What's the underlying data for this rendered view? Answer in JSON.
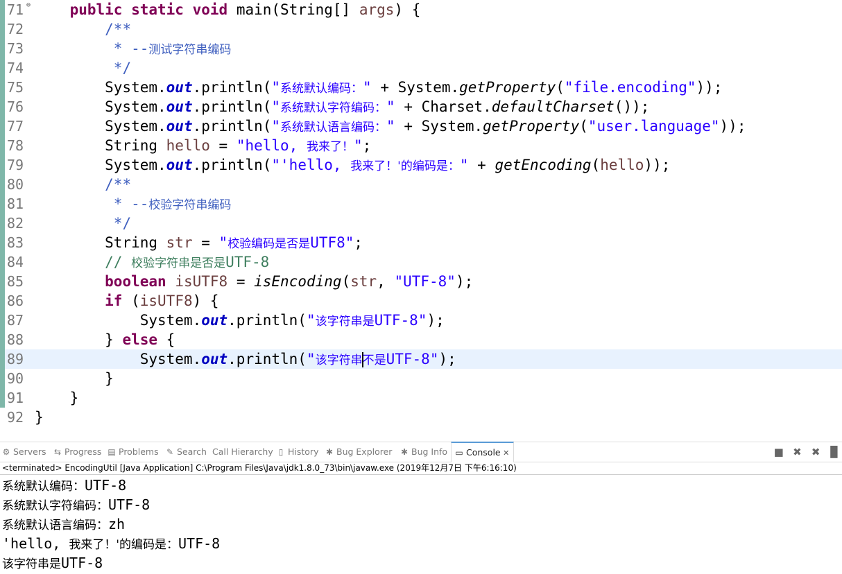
{
  "editor": {
    "lines": [
      {
        "num": "71",
        "fold": "⊖",
        "segs": [
          {
            "t": "    "
          },
          {
            "t": "public",
            "c": "kw"
          },
          {
            "t": " "
          },
          {
            "t": "static",
            "c": "kw"
          },
          {
            "t": " "
          },
          {
            "t": "void",
            "c": "kw"
          },
          {
            "t": " main(String[] "
          },
          {
            "t": "args",
            "c": "var"
          },
          {
            "t": ") {"
          }
        ]
      },
      {
        "num": "72",
        "segs": [
          {
            "t": "        "
          },
          {
            "t": "/**",
            "c": "jd"
          }
        ]
      },
      {
        "num": "73",
        "segs": [
          {
            "t": "         "
          },
          {
            "t": "* --",
            "c": "jd"
          },
          {
            "t": "测试字符串编码",
            "c": "jd zh"
          }
        ]
      },
      {
        "num": "74",
        "segs": [
          {
            "t": "         "
          },
          {
            "t": "*/",
            "c": "jd"
          }
        ]
      },
      {
        "num": "75",
        "segs": [
          {
            "t": "        System."
          },
          {
            "t": "out",
            "c": "fld"
          },
          {
            "t": ".println("
          },
          {
            "t": "\"",
            "c": "str"
          },
          {
            "t": "系统默认编码：",
            "c": "str zh"
          },
          {
            "t": "\"",
            "c": "str"
          },
          {
            "t": " + System."
          },
          {
            "t": "getProperty",
            "c": "sm"
          },
          {
            "t": "("
          },
          {
            "t": "\"file.encoding\"",
            "c": "str"
          },
          {
            "t": "));"
          }
        ]
      },
      {
        "num": "76",
        "segs": [
          {
            "t": "        System."
          },
          {
            "t": "out",
            "c": "fld"
          },
          {
            "t": ".println("
          },
          {
            "t": "\"",
            "c": "str"
          },
          {
            "t": "系统默认字符编码：",
            "c": "str zh"
          },
          {
            "t": "\"",
            "c": "str"
          },
          {
            "t": " + Charset."
          },
          {
            "t": "defaultCharset",
            "c": "sm"
          },
          {
            "t": "());"
          }
        ]
      },
      {
        "num": "77",
        "segs": [
          {
            "t": "        System."
          },
          {
            "t": "out",
            "c": "fld"
          },
          {
            "t": ".println("
          },
          {
            "t": "\"",
            "c": "str"
          },
          {
            "t": "系统默认语言编码：",
            "c": "str zh"
          },
          {
            "t": "\"",
            "c": "str"
          },
          {
            "t": " + System."
          },
          {
            "t": "getProperty",
            "c": "sm"
          },
          {
            "t": "("
          },
          {
            "t": "\"user.language\"",
            "c": "str"
          },
          {
            "t": "));"
          }
        ]
      },
      {
        "num": "78",
        "segs": [
          {
            "t": "        String "
          },
          {
            "t": "hello",
            "c": "var"
          },
          {
            "t": " = "
          },
          {
            "t": "\"hello, ",
            "c": "str"
          },
          {
            "t": "我来了！",
            "c": "str zh"
          },
          {
            "t": "\"",
            "c": "str"
          },
          {
            "t": ";"
          }
        ]
      },
      {
        "num": "79",
        "segs": [
          {
            "t": "        System."
          },
          {
            "t": "out",
            "c": "fld"
          },
          {
            "t": ".println("
          },
          {
            "t": "\"'hello, ",
            "c": "str"
          },
          {
            "t": "我来了！'的编码是：",
            "c": "str zh"
          },
          {
            "t": "\"",
            "c": "str"
          },
          {
            "t": " + "
          },
          {
            "t": "getEncoding",
            "c": "sm"
          },
          {
            "t": "("
          },
          {
            "t": "hello",
            "c": "var"
          },
          {
            "t": "));"
          }
        ]
      },
      {
        "num": "80",
        "segs": [
          {
            "t": "        "
          },
          {
            "t": "/**",
            "c": "jd"
          }
        ]
      },
      {
        "num": "81",
        "segs": [
          {
            "t": "         "
          },
          {
            "t": "* --",
            "c": "jd"
          },
          {
            "t": "校验字符串编码",
            "c": "jd zh"
          }
        ]
      },
      {
        "num": "82",
        "segs": [
          {
            "t": "         "
          },
          {
            "t": "*/",
            "c": "jd"
          }
        ]
      },
      {
        "num": "83",
        "segs": [
          {
            "t": "        String "
          },
          {
            "t": "str",
            "c": "var"
          },
          {
            "t": " = "
          },
          {
            "t": "\"",
            "c": "str"
          },
          {
            "t": "校验编码是否是",
            "c": "str zh"
          },
          {
            "t": "UTF8\"",
            "c": "str"
          },
          {
            "t": ";"
          }
        ]
      },
      {
        "num": "84",
        "segs": [
          {
            "t": "        "
          },
          {
            "t": "// ",
            "c": "cm"
          },
          {
            "t": "校验字符串是否是",
            "c": "cm zh"
          },
          {
            "t": "UTF-8",
            "c": "cm"
          }
        ]
      },
      {
        "num": "85",
        "segs": [
          {
            "t": "        "
          },
          {
            "t": "boolean",
            "c": "kw"
          },
          {
            "t": " "
          },
          {
            "t": "isUTF8",
            "c": "var"
          },
          {
            "t": " = "
          },
          {
            "t": "isEncoding",
            "c": "sm"
          },
          {
            "t": "("
          },
          {
            "t": "str",
            "c": "var"
          },
          {
            "t": ", "
          },
          {
            "t": "\"UTF-8\"",
            "c": "str"
          },
          {
            "t": ");"
          }
        ]
      },
      {
        "num": "86",
        "segs": [
          {
            "t": "        "
          },
          {
            "t": "if",
            "c": "kw"
          },
          {
            "t": " ("
          },
          {
            "t": "isUTF8",
            "c": "var"
          },
          {
            "t": ") {"
          }
        ]
      },
      {
        "num": "87",
        "segs": [
          {
            "t": "            System."
          },
          {
            "t": "out",
            "c": "fld"
          },
          {
            "t": ".println("
          },
          {
            "t": "\"",
            "c": "str"
          },
          {
            "t": "该字符串是",
            "c": "str zh"
          },
          {
            "t": "UTF-8\"",
            "c": "str"
          },
          {
            "t": ");"
          }
        ]
      },
      {
        "num": "88",
        "segs": [
          {
            "t": "        } "
          },
          {
            "t": "else",
            "c": "kw"
          },
          {
            "t": " {"
          }
        ]
      },
      {
        "num": "89",
        "current": true,
        "segs": [
          {
            "t": "            System."
          },
          {
            "t": "out",
            "c": "fld"
          },
          {
            "t": ".println("
          },
          {
            "t": "\"",
            "c": "str"
          },
          {
            "t": "该字符串",
            "c": "str zh"
          },
          {
            "cursor": true
          },
          {
            "t": "不是",
            "c": "str zh"
          },
          {
            "t": "UTF-8\"",
            "c": "str"
          },
          {
            "t": ");"
          }
        ]
      },
      {
        "num": "90",
        "segs": [
          {
            "t": "        }"
          }
        ]
      },
      {
        "num": "91",
        "segs": [
          {
            "t": "    }"
          }
        ]
      },
      {
        "num": "92",
        "nobar": true,
        "segs": [
          {
            "t": "}"
          }
        ]
      }
    ]
  },
  "views": {
    "tabs": [
      {
        "name": "tab-servers",
        "icon": "servers-icon",
        "glyph": "⚙",
        "label": "Servers",
        "active": false
      },
      {
        "name": "tab-progress",
        "icon": "progress-icon",
        "glyph": "⇆",
        "label": "Progress",
        "active": false
      },
      {
        "name": "tab-problems",
        "icon": "problems-icon",
        "glyph": "▤",
        "label": "Problems",
        "active": false
      },
      {
        "name": "tab-search",
        "icon": "search-icon",
        "glyph": "✎",
        "label": "Search",
        "active": false
      },
      {
        "name": "tab-call-hierarchy",
        "icon": "call-hierarchy-icon",
        "glyph": "",
        "label": "Call Hierarchy",
        "active": false
      },
      {
        "name": "tab-history",
        "icon": "history-icon",
        "glyph": "▯",
        "label": "History",
        "active": false
      },
      {
        "name": "tab-bug-explorer",
        "icon": "bug-explorer-icon",
        "glyph": "✱",
        "label": "Bug Explorer",
        "active": false
      },
      {
        "name": "tab-bug-info",
        "icon": "bug-info-icon",
        "glyph": "✱",
        "label": "Bug Info",
        "active": false
      },
      {
        "name": "tab-console",
        "icon": "console-icon",
        "glyph": "▭",
        "label": "Console",
        "active": true,
        "close": "✕"
      }
    ]
  },
  "console": {
    "status": "<terminated> EncodingUtil [Java Application] C:\\Program Files\\Java\\jdk1.8.0_73\\bin\\javaw.exe (2019年12月7日 下午6:16:10)",
    "lines": [
      [
        {
          "t": "系统默认编码：",
          "c": "zh"
        },
        {
          "t": "UTF-8"
        }
      ],
      [
        {
          "t": "系统默认字符编码：",
          "c": "zh"
        },
        {
          "t": "UTF-8"
        }
      ],
      [
        {
          "t": "系统默认语言编码：",
          "c": "zh"
        },
        {
          "t": "zh"
        }
      ],
      [
        {
          "t": "'hello, "
        },
        {
          "t": "我来了！'的编码是：",
          "c": "zh"
        },
        {
          "t": "UTF-8"
        }
      ],
      [
        {
          "t": "该字符串是",
          "c": "zh"
        },
        {
          "t": "UTF-8"
        }
      ]
    ]
  }
}
